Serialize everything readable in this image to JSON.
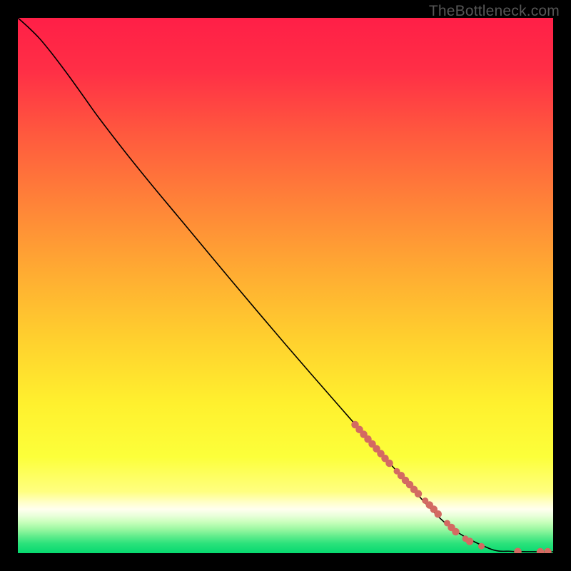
{
  "watermark": "TheBottleneck.com",
  "colors": {
    "curve": "#000000",
    "marker": "#d36a62"
  },
  "chart_data": {
    "type": "line",
    "title": "",
    "xlabel": "",
    "ylabel": "",
    "xlim": [
      0,
      100
    ],
    "ylim": [
      0,
      100
    ],
    "curve": {
      "x": [
        0.0,
        2.0,
        4.0,
        6.0,
        8.0,
        10.0,
        12.5,
        15.0,
        20.0,
        25.0,
        30.0,
        40.0,
        50.0,
        60.0,
        70.0,
        80.0,
        88.0,
        92.0,
        93.5,
        95.0,
        96.0,
        97.0,
        98.0,
        99.0,
        100.0
      ],
      "y": [
        100.0,
        98.2,
        96.2,
        93.8,
        91.2,
        88.5,
        85.0,
        81.5,
        75.0,
        68.8,
        62.8,
        50.8,
        39.0,
        27.5,
        16.2,
        5.5,
        0.9,
        0.35,
        0.3,
        0.28,
        0.27,
        0.27,
        0.26,
        0.26,
        0.26
      ]
    },
    "markers": [
      {
        "x": 63.0,
        "y": 24.0,
        "r": 0.7
      },
      {
        "x": 63.8,
        "y": 23.1,
        "r": 0.7
      },
      {
        "x": 64.6,
        "y": 22.2,
        "r": 0.7
      },
      {
        "x": 65.4,
        "y": 21.3,
        "r": 0.7
      },
      {
        "x": 66.2,
        "y": 20.4,
        "r": 0.7
      },
      {
        "x": 67.0,
        "y": 19.5,
        "r": 0.7
      },
      {
        "x": 67.8,
        "y": 18.6,
        "r": 0.7
      },
      {
        "x": 68.6,
        "y": 17.7,
        "r": 0.7
      },
      {
        "x": 69.4,
        "y": 16.8,
        "r": 0.7
      },
      {
        "x": 70.8,
        "y": 15.3,
        "r": 0.6
      },
      {
        "x": 71.6,
        "y": 14.5,
        "r": 0.7
      },
      {
        "x": 72.4,
        "y": 13.6,
        "r": 0.7
      },
      {
        "x": 73.2,
        "y": 12.8,
        "r": 0.7
      },
      {
        "x": 74.0,
        "y": 11.9,
        "r": 0.7
      },
      {
        "x": 74.8,
        "y": 11.1,
        "r": 0.7
      },
      {
        "x": 76.1,
        "y": 9.8,
        "r": 0.6
      },
      {
        "x": 76.9,
        "y": 9.0,
        "r": 0.7
      },
      {
        "x": 77.7,
        "y": 8.2,
        "r": 0.7
      },
      {
        "x": 78.5,
        "y": 7.3,
        "r": 0.7
      },
      {
        "x": 80.2,
        "y": 5.6,
        "r": 0.6
      },
      {
        "x": 81.0,
        "y": 4.8,
        "r": 0.7
      },
      {
        "x": 81.8,
        "y": 4.0,
        "r": 0.7
      },
      {
        "x": 83.6,
        "y": 2.7,
        "r": 0.6
      },
      {
        "x": 84.4,
        "y": 2.2,
        "r": 0.7
      },
      {
        "x": 86.6,
        "y": 1.3,
        "r": 0.6
      },
      {
        "x": 93.4,
        "y": 0.3,
        "r": 0.7
      },
      {
        "x": 97.6,
        "y": 0.26,
        "r": 0.7
      },
      {
        "x": 99.0,
        "y": 0.26,
        "r": 0.7
      }
    ]
  }
}
